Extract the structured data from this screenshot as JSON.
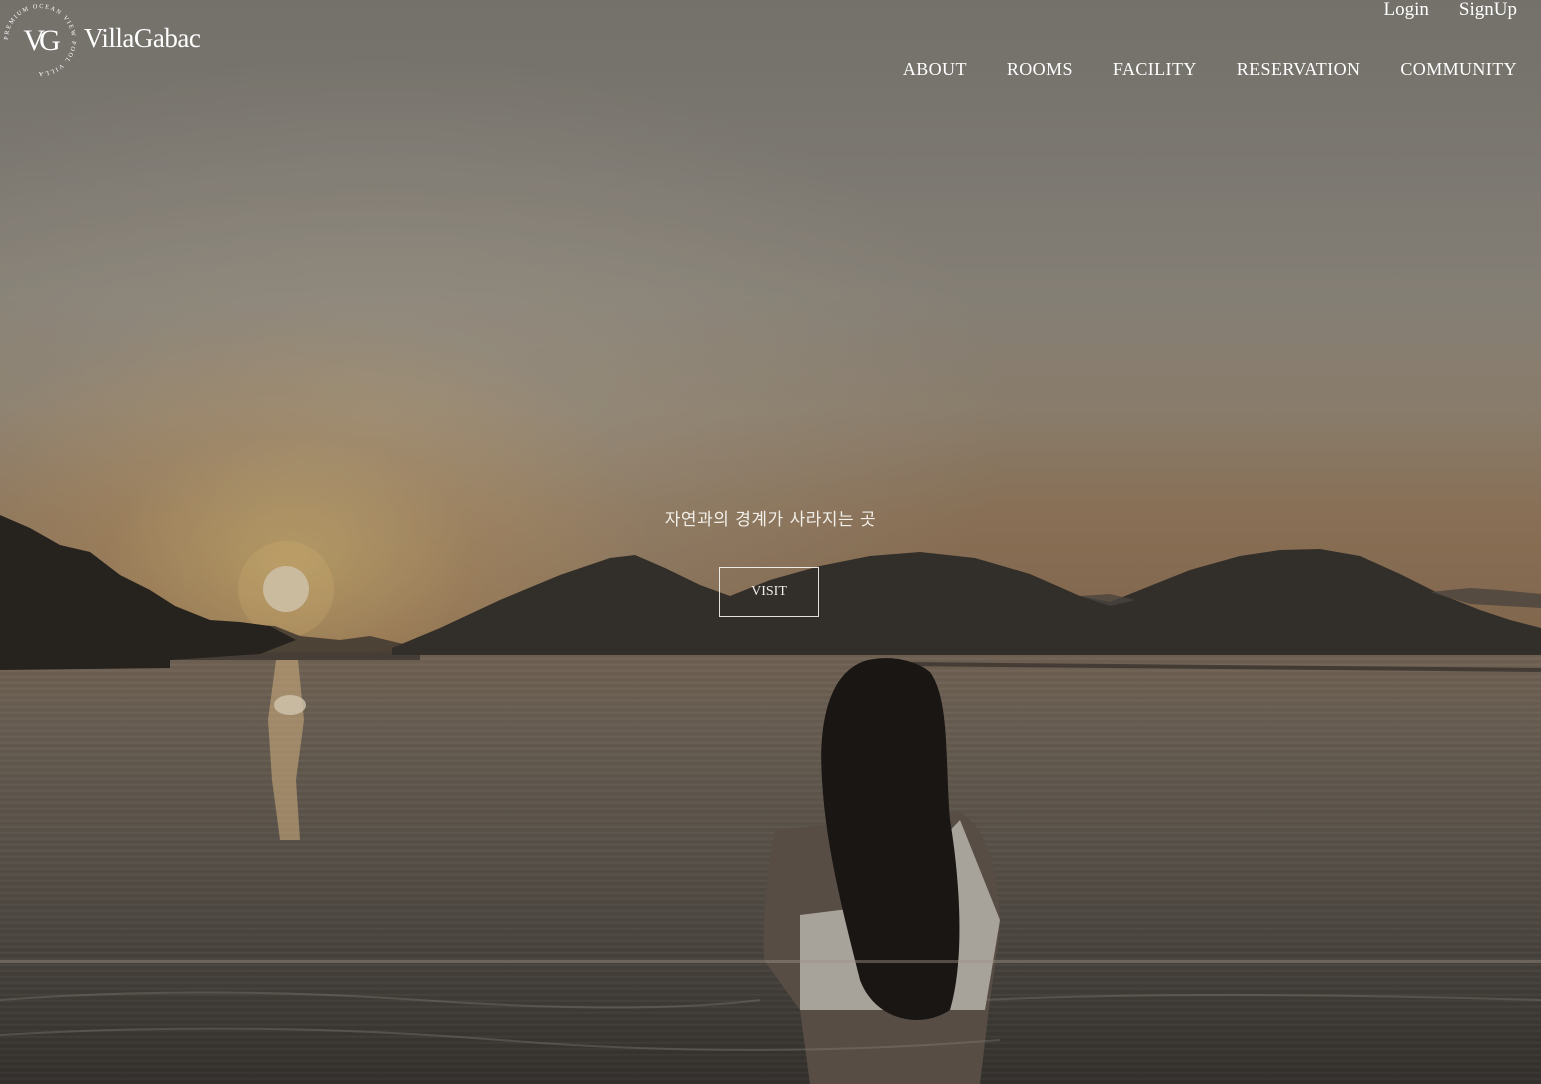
{
  "brand": {
    "name": "VillaGabac",
    "monogram": "VG",
    "badge_ring_text": "PREMIUM OCEAN VIEW POOL VILLA"
  },
  "auth": {
    "login_label": "Login",
    "signup_label": "SignUp"
  },
  "nav": {
    "items": [
      {
        "label": "ABOUT"
      },
      {
        "label": "ROOMS"
      },
      {
        "label": "FACILITY"
      },
      {
        "label": "RESERVATION"
      },
      {
        "label": "COMMUNITY"
      }
    ]
  },
  "hero": {
    "tagline": "자연과의 경계가 사라지는 곳",
    "cta_label": "VISIT",
    "image": "sunset-sea-infinity-pool-photo"
  },
  "colors": {
    "text": "#ffffff",
    "overlay": "rgba(0,0,0,0.18)",
    "sun": "#f6e7cf",
    "mountain": "#3f3a35"
  }
}
